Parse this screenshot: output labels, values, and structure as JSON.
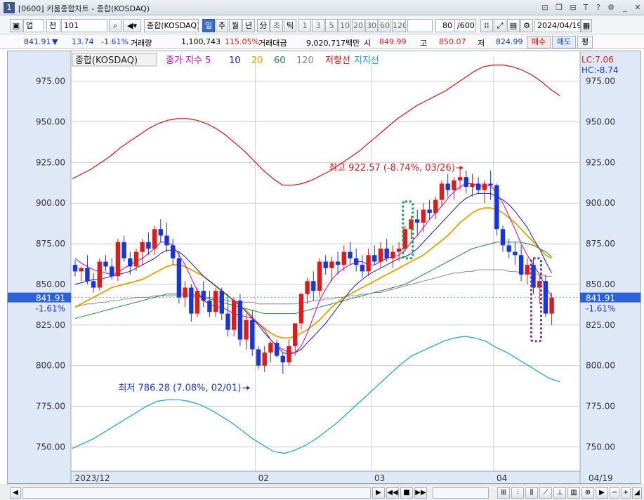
{
  "window": {
    "num": "1",
    "title": "[0600] 키움종합차트 - 종합(KOSDAQ)"
  },
  "toolbar": {
    "market": "업",
    "prev": "전",
    "code": "101",
    "name": "종합(KOSDAQ)",
    "periods": [
      "일",
      "주",
      "월",
      "년",
      "分",
      "초",
      "틱"
    ],
    "active_period": "일",
    "intervals": [
      "1",
      "3",
      "5",
      "10",
      "20",
      "30",
      "60",
      "120"
    ],
    "count": "80",
    "count_total": "/600",
    "date": "2024/04/19"
  },
  "quote": {
    "price": "841.91",
    "change": "13.74",
    "change_pct": "-1.61%",
    "volume_label": "거래량",
    "volume": "1,100,743",
    "volume_ratio": "115.05%",
    "amount_label": "거래대금",
    "amount": "9,020,717백만",
    "open_label": "시",
    "open": "849.99",
    "high_label": "고",
    "high": "850.07",
    "low_label": "저",
    "low": "824.99",
    "buy_label": "매수",
    "sell_label": "매도",
    "avg_label": "평"
  },
  "colors": {
    "up": "#e0191a",
    "down": "#1a35d6",
    "ma5": "#c000c0",
    "ma10": "#1a1aa0",
    "ma20": "#e8a000",
    "ma60": "#1e8a3c",
    "ma120": "#888888",
    "resistance": "#d21010",
    "support": "#14a0c8",
    "grid": "#cccccc"
  },
  "chart_data": {
    "type": "candlestick",
    "title": "종합(KOSDAQ)",
    "legend_prefix": "종가 지수 5",
    "legend": [
      {
        "name": "5",
        "key": "ma5"
      },
      {
        "name": "10",
        "key": "ma10"
      },
      {
        "name": "20",
        "key": "ma20"
      },
      {
        "name": "60",
        "key": "ma60"
      },
      {
        "name": "120",
        "key": "ma120"
      },
      {
        "name": "저항선",
        "key": "resistance"
      },
      {
        "name": "지지선",
        "key": "support"
      }
    ],
    "lc_label": "LC:7.06",
    "hc_label": "HC:-8.74",
    "ylim": [
      735,
      990
    ],
    "yticks": [
      975,
      950,
      925,
      900,
      875,
      850,
      825,
      800,
      775,
      750
    ],
    "ytick_labels": [
      "975.00",
      "950.00",
      "925.00",
      "900.00",
      "875.00",
      "850.00",
      "825.00",
      "800.00",
      "775.00",
      "750.00"
    ],
    "x_labels": [
      {
        "label": "2023/12",
        "index": 0
      },
      {
        "label": "02",
        "index": 30
      },
      {
        "label": "03",
        "index": 49
      },
      {
        "label": "04",
        "index": 69
      }
    ],
    "last_date_label": "04/19",
    "current_price_label": "841.91",
    "current_change_label": "-1.61%",
    "current_price": 841.91,
    "high_annotation": {
      "text": "최고 922.57 (-8.74%, 03/26)",
      "value": 922.57,
      "index": 64
    },
    "low_annotation": {
      "text": "최저 786.28 (7.08%, 02/01)",
      "value": 786.28,
      "index": 29
    },
    "candles": [
      [
        862,
        865,
        855,
        858
      ],
      [
        858,
        861,
        852,
        860
      ],
      [
        860,
        868,
        850,
        852
      ],
      [
        852,
        857,
        845,
        848
      ],
      [
        848,
        866,
        846,
        864
      ],
      [
        864,
        868,
        858,
        861
      ],
      [
        861,
        866,
        853,
        855
      ],
      [
        855,
        878,
        852,
        876
      ],
      [
        876,
        880,
        864,
        866
      ],
      [
        866,
        870,
        856,
        861
      ],
      [
        861,
        872,
        858,
        870
      ],
      [
        870,
        878,
        862,
        876
      ],
      [
        876,
        882,
        868,
        872
      ],
      [
        872,
        886,
        868,
        884
      ],
      [
        884,
        890,
        876,
        880
      ],
      [
        880,
        888,
        870,
        874
      ],
      [
        874,
        878,
        862,
        866
      ],
      [
        866,
        870,
        838,
        842
      ],
      [
        842,
        852,
        836,
        848
      ],
      [
        848,
        850,
        827,
        832
      ],
      [
        832,
        848,
        830,
        846
      ],
      [
        846,
        852,
        836,
        840
      ],
      [
        840,
        846,
        830,
        833
      ],
      [
        833,
        848,
        830,
        846
      ],
      [
        846,
        848,
        828,
        832
      ],
      [
        832,
        844,
        818,
        822
      ],
      [
        822,
        842,
        818,
        840
      ],
      [
        840,
        844,
        812,
        816
      ],
      [
        816,
        832,
        810,
        828
      ],
      [
        828,
        834,
        806,
        810
      ],
      [
        810,
        812,
        798,
        800
      ],
      [
        800,
        812,
        796,
        808
      ],
      [
        808,
        815,
        802,
        814
      ],
      [
        814,
        816,
        805,
        806
      ],
      [
        806,
        808,
        795,
        802
      ],
      [
        802,
        816,
        800,
        812
      ],
      [
        812,
        826,
        806,
        826
      ],
      [
        826,
        845,
        822,
        844
      ],
      [
        844,
        854,
        838,
        852
      ],
      [
        852,
        858,
        840,
        846
      ],
      [
        846,
        866,
        842,
        864
      ],
      [
        864,
        868,
        856,
        860
      ],
      [
        860,
        867,
        852,
        864
      ],
      [
        864,
        870,
        856,
        862
      ],
      [
        862,
        874,
        858,
        870
      ],
      [
        870,
        876,
        862,
        866
      ],
      [
        866,
        872,
        858,
        862
      ],
      [
        862,
        868,
        854,
        858
      ],
      [
        858,
        872,
        855,
        868
      ],
      [
        868,
        874,
        862,
        864
      ],
      [
        864,
        876,
        860,
        872
      ],
      [
        872,
        878,
        864,
        866
      ],
      [
        866,
        874,
        860,
        870
      ],
      [
        870,
        876,
        864,
        872
      ],
      [
        872,
        886,
        870,
        884
      ],
      [
        884,
        892,
        878,
        890
      ],
      [
        890,
        896,
        880,
        888
      ],
      [
        888,
        900,
        882,
        896
      ],
      [
        896,
        902,
        890,
        894
      ],
      [
        894,
        904,
        890,
        902
      ],
      [
        902,
        914,
        898,
        912
      ],
      [
        912,
        918,
        904,
        908
      ],
      [
        908,
        916,
        902,
        914
      ],
      [
        914,
        922.57,
        908,
        916
      ],
      [
        916,
        920,
        906,
        910
      ],
      [
        910,
        918,
        904,
        912
      ],
      [
        912,
        916,
        906,
        908
      ],
      [
        908,
        914,
        900,
        912
      ],
      [
        912,
        920,
        902,
        911
      ],
      [
        911,
        912,
        880,
        884
      ],
      [
        884,
        886,
        870,
        874
      ],
      [
        874,
        878,
        866,
        870
      ],
      [
        870,
        876,
        862,
        868
      ],
      [
        868,
        874,
        852,
        856
      ],
      [
        856,
        866,
        850,
        862
      ],
      [
        862,
        866,
        844,
        848
      ],
      [
        848,
        856,
        838,
        852
      ],
      [
        852,
        856,
        830,
        832
      ],
      [
        832,
        845,
        825,
        841.91
      ]
    ],
    "ma5": [
      866,
      863,
      861,
      859,
      858,
      857,
      856,
      857,
      860,
      862,
      864,
      866,
      869,
      872,
      876,
      876,
      874,
      868,
      862,
      854,
      846,
      840,
      838,
      836,
      836,
      834,
      832,
      831,
      830,
      829,
      826,
      822,
      816,
      812,
      810,
      808,
      808,
      812,
      820,
      830,
      840,
      847,
      853,
      857,
      860,
      862,
      864,
      864,
      862,
      862,
      864,
      866,
      867,
      868,
      871,
      876,
      880,
      885,
      890,
      894,
      898,
      903,
      907,
      910,
      912,
      912,
      911,
      910,
      911,
      906,
      900,
      892,
      884,
      875,
      868,
      862,
      856,
      849,
      842
    ],
    "ma10": [
      850,
      851,
      852,
      853,
      853,
      854,
      855,
      856,
      857,
      858,
      860,
      862,
      864,
      866,
      869,
      871,
      871,
      870,
      867,
      863,
      859,
      855,
      852,
      849,
      846,
      843,
      840,
      837,
      833,
      829,
      825,
      820,
      816,
      812,
      808,
      807,
      808,
      810,
      814,
      818,
      822,
      826,
      831,
      836,
      841,
      846,
      850,
      853,
      856,
      858,
      860,
      862,
      864,
      866,
      867,
      869,
      872,
      876,
      880,
      884,
      888,
      892,
      896,
      900,
      903,
      905,
      906,
      906,
      906,
      904,
      902,
      899,
      895,
      890,
      885,
      878,
      872,
      864,
      857
    ],
    "ma20": [
      836,
      838,
      840,
      842,
      844,
      846,
      848,
      849,
      850,
      851,
      852,
      853,
      855,
      857,
      859,
      861,
      862,
      862,
      861,
      859,
      857,
      855,
      852,
      849,
      846,
      843,
      840,
      837,
      834,
      830,
      826,
      823,
      820,
      818,
      817,
      817,
      818,
      820,
      822,
      825,
      828,
      832,
      836,
      839,
      842,
      844,
      846,
      848,
      850,
      852,
      854,
      856,
      858,
      860,
      862,
      864,
      866,
      868,
      871,
      874,
      877,
      880,
      884,
      888,
      891,
      894,
      896,
      897,
      897,
      896,
      894,
      891,
      888,
      884,
      880,
      876,
      872,
      868,
      866
    ],
    "ma60": [
      829,
      830,
      831,
      832,
      833,
      834,
      835,
      836,
      837,
      838,
      839,
      840,
      841,
      842,
      843,
      844,
      844,
      844,
      844,
      844,
      843,
      842,
      841,
      840,
      839,
      838,
      837,
      836,
      835,
      834,
      833,
      832,
      832,
      832,
      832,
      832,
      832,
      833,
      834,
      835,
      836,
      837,
      838,
      839,
      840,
      841,
      842,
      843,
      844,
      845,
      846,
      847,
      848,
      849,
      850,
      852,
      854,
      856,
      858,
      860,
      862,
      864,
      866,
      868,
      870,
      872,
      873,
      874,
      875,
      876,
      876,
      876,
      876,
      876,
      875,
      874,
      872,
      870,
      867
    ],
    "ma120": [
      836,
      837,
      838,
      838,
      839,
      839,
      840,
      840,
      841,
      841,
      842,
      842,
      842,
      843,
      843,
      843,
      843,
      843,
      843,
      843,
      842,
      842,
      842,
      841,
      841,
      840,
      840,
      839,
      839,
      839,
      838,
      838,
      838,
      838,
      838,
      838,
      838,
      839,
      839,
      840,
      840,
      841,
      841,
      842,
      842,
      843,
      843,
      844,
      844,
      845,
      845,
      846,
      847,
      848,
      849,
      850,
      851,
      852,
      853,
      854,
      855,
      856,
      857,
      857,
      858,
      858,
      859,
      859,
      859,
      859,
      859,
      858,
      858,
      857,
      857,
      856,
      856,
      855,
      855
    ],
    "resistance": [
      915,
      918,
      921,
      925,
      929,
      934,
      938,
      942,
      946,
      949,
      951,
      952,
      952,
      951,
      949,
      946,
      942,
      937,
      932,
      926,
      920,
      915,
      911,
      911,
      912,
      914,
      917,
      920,
      924,
      928,
      932,
      937,
      942,
      947,
      952,
      956,
      960,
      963,
      966,
      969,
      973,
      977,
      981,
      984,
      985,
      985,
      984,
      982,
      979,
      975,
      970,
      966
    ],
    "support": [
      749,
      752,
      755,
      759,
      763,
      767,
      771,
      775,
      778,
      779,
      779,
      778,
      776,
      773,
      769,
      765,
      760,
      755,
      751,
      747,
      746,
      748,
      751,
      755,
      760,
      765,
      771,
      777,
      783,
      789,
      795,
      801,
      806,
      809,
      812,
      815,
      817,
      818,
      817,
      815,
      811,
      808,
      804,
      800,
      796,
      792,
      790
    ]
  },
  "scroll": {
    "play": "▶",
    "step_back": "◀◀",
    "stop": "■",
    "step_fwd": "▶▶",
    "zoom_minus": "−",
    "zoom_plus": "+"
  }
}
